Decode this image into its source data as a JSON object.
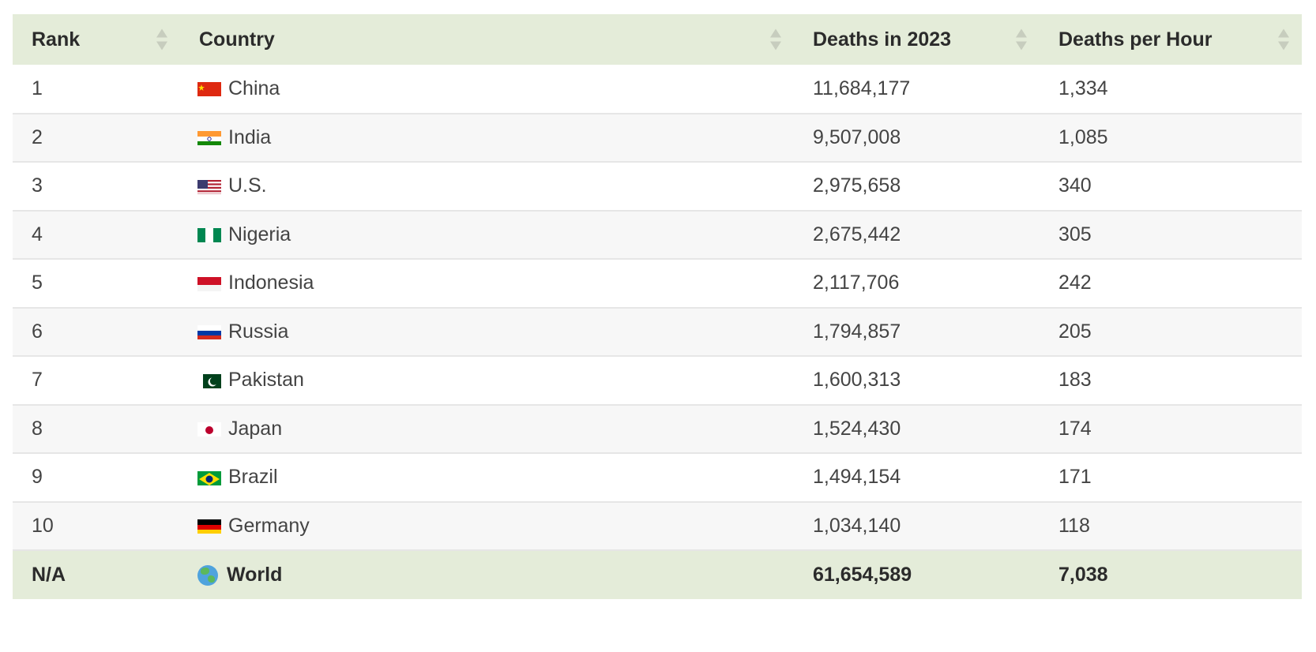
{
  "table": {
    "headers": {
      "rank": "Rank",
      "country": "Country",
      "deaths": "Deaths in 2023",
      "per_hour": "Deaths per Hour"
    },
    "rows": [
      {
        "rank": "1",
        "country": "China",
        "flag": "china-flag-icon",
        "deaths": "11,684,177",
        "per_hour": "1,334"
      },
      {
        "rank": "2",
        "country": "India",
        "flag": "india-flag-icon",
        "deaths": "9,507,008",
        "per_hour": "1,085"
      },
      {
        "rank": "3",
        "country": "U.S.",
        "flag": "us-flag-icon",
        "deaths": "2,975,658",
        "per_hour": "340"
      },
      {
        "rank": "4",
        "country": "Nigeria",
        "flag": "nigeria-flag-icon",
        "deaths": "2,675,442",
        "per_hour": "305"
      },
      {
        "rank": "5",
        "country": "Indonesia",
        "flag": "indonesia-flag-icon",
        "deaths": "2,117,706",
        "per_hour": "242"
      },
      {
        "rank": "6",
        "country": "Russia",
        "flag": "russia-flag-icon",
        "deaths": "1,794,857",
        "per_hour": "205"
      },
      {
        "rank": "7",
        "country": "Pakistan",
        "flag": "pakistan-flag-icon",
        "deaths": "1,600,313",
        "per_hour": "183"
      },
      {
        "rank": "8",
        "country": "Japan",
        "flag": "japan-flag-icon",
        "deaths": "1,524,430",
        "per_hour": "174"
      },
      {
        "rank": "9",
        "country": "Brazil",
        "flag": "brazil-flag-icon",
        "deaths": "1,494,154",
        "per_hour": "171"
      },
      {
        "rank": "10",
        "country": "Germany",
        "flag": "germany-flag-icon",
        "deaths": "1,034,140",
        "per_hour": "118"
      }
    ],
    "footer": {
      "rank": "N/A",
      "country": "World",
      "icon": "globe-icon",
      "deaths": "61,654,589",
      "per_hour": "7,038"
    }
  },
  "colors": {
    "header_bg": "#e4ecd9",
    "footer_bg": "#e4ecd9",
    "stripe_bg": "#f7f7f7",
    "sort_arrow": "#c7cdbe"
  }
}
